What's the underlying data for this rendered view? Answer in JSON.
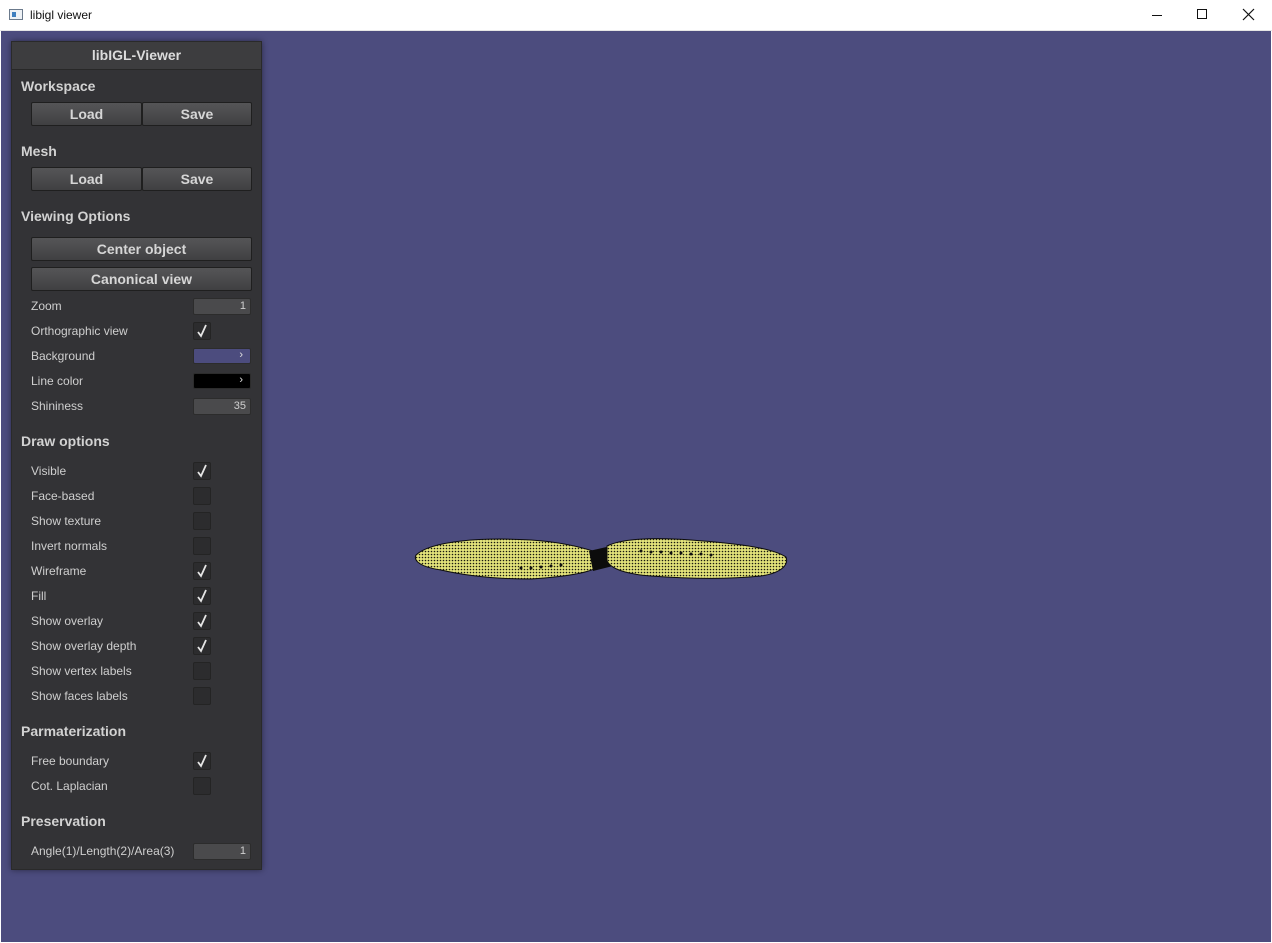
{
  "window": {
    "title": "libigl viewer"
  },
  "panel": {
    "title": "libIGL-Viewer",
    "workspace": {
      "heading": "Workspace",
      "load": "Load",
      "save": "Save"
    },
    "mesh": {
      "heading": "Mesh",
      "load": "Load",
      "save": "Save"
    },
    "viewing": {
      "heading": "Viewing Options",
      "center_object": "Center object",
      "canonical_view": "Canonical view",
      "zoom_label": "Zoom",
      "zoom_value": "1",
      "ortho_label": "Orthographic view",
      "ortho_checked": true,
      "background_label": "Background",
      "background_color": "#4c4c7e",
      "line_color_label": "Line color",
      "line_color": "#000000",
      "shininess_label": "Shininess",
      "shininess_value": "35"
    },
    "draw": {
      "heading": "Draw options",
      "options": [
        {
          "label": "Visible",
          "checked": true
        },
        {
          "label": "Face-based",
          "checked": false
        },
        {
          "label": "Show texture",
          "checked": false
        },
        {
          "label": "Invert normals",
          "checked": false
        },
        {
          "label": "Wireframe",
          "checked": true
        },
        {
          "label": "Fill",
          "checked": true
        },
        {
          "label": "Show overlay",
          "checked": true
        },
        {
          "label": "Show overlay depth",
          "checked": true
        },
        {
          "label": "Show vertex labels",
          "checked": false
        },
        {
          "label": "Show faces labels",
          "checked": false
        }
      ]
    },
    "param": {
      "heading": "Parmaterization",
      "options": [
        {
          "label": "Free boundary",
          "checked": true
        },
        {
          "label": "Cot. Laplacian",
          "checked": false
        }
      ]
    },
    "preservation": {
      "heading": "Preservation",
      "label": "Angle(1)/Length(2)/Area(3)",
      "value": "1"
    }
  },
  "colors": {
    "viewport_bg": "#4c4c7e",
    "mesh_fill": "#dede78",
    "mesh_wire": "#000000"
  }
}
